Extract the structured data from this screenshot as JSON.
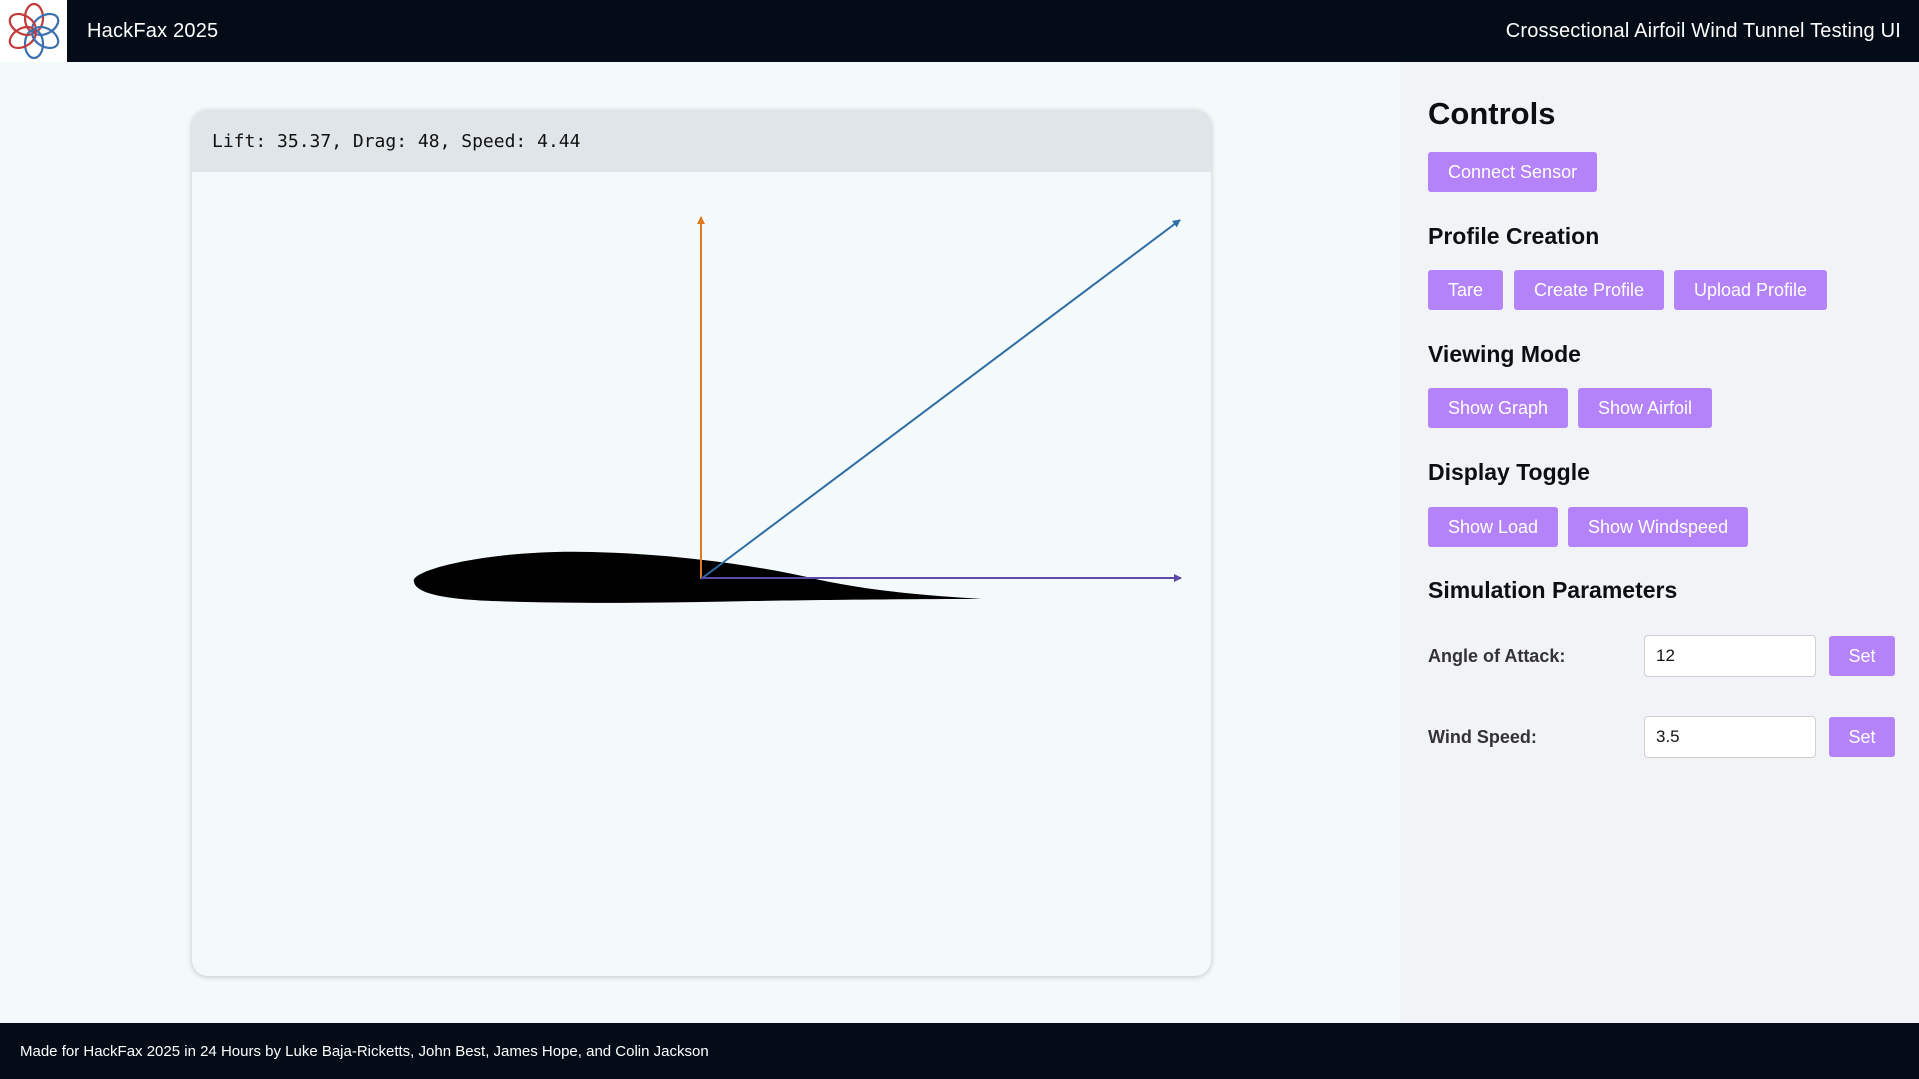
{
  "header": {
    "title": "HackFax 2025",
    "right_title": "Crossectional Airfoil Wind Tunnel Testing UI",
    "logo_icon": "flower-logo-icon"
  },
  "readout": {
    "text": "Lift: 35.37, Drag: 48, Speed: 4.44"
  },
  "vectors": {
    "lift_color": "#e07b1c",
    "result_color": "#2e6da4",
    "drag_color": "#5b4aa8",
    "airfoil_color": "#000000"
  },
  "sidebar": {
    "controls_heading": "Controls",
    "connect_sensor": "Connect Sensor",
    "profile_heading": "Profile Creation",
    "tare": "Tare",
    "create_profile": "Create Profile",
    "upload_profile": "Upload Profile",
    "viewing_heading": "Viewing Mode",
    "show_graph": "Show Graph",
    "show_airfoil": "Show Airfoil",
    "display_heading": "Display Toggle",
    "show_load": "Show Load",
    "show_windspeed": "Show Windspeed",
    "sim_heading": "Simulation Parameters",
    "angle_label": "Angle of Attack:",
    "angle_value": "12",
    "wind_label": "Wind Speed:",
    "wind_value": "3.5",
    "set_label": "Set",
    "accent_color": "#b482f9"
  },
  "footer": {
    "text": "Made for HackFax 2025 in 24 Hours by Luke Baja-Ricketts, John Best, James Hope, and Colin Jackson"
  }
}
